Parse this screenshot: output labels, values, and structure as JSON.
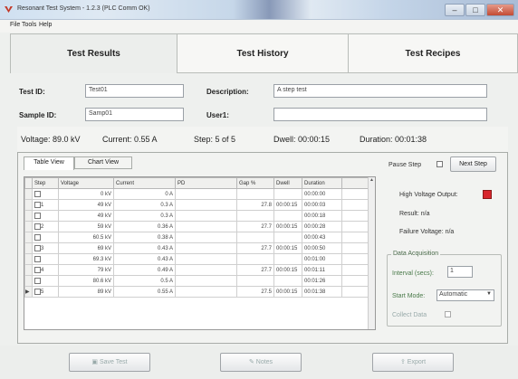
{
  "window": {
    "title": "Resonant Test System - 1.2.3 (PLC Comm OK)",
    "min_glyph": "–",
    "max_glyph": "□",
    "close_glyph": "✕"
  },
  "menu": [
    "File",
    "Tools",
    "Help"
  ],
  "tabs": [
    "Test Results",
    "Test History",
    "Test Recipes"
  ],
  "form": {
    "test_id_label": "Test ID:",
    "test_id_value": "Test01",
    "description_label": "Description:",
    "description_value": "A step test",
    "sample_id_label": "Sample ID:",
    "sample_id_value": "Samp01",
    "user_label": "User1:",
    "user_value": ""
  },
  "status": {
    "voltage": "Voltage: 89.0 kV",
    "current": "Current: 0.55 A",
    "step": "Step: 5 of 5",
    "dwell": "Dwell: 00:00:15",
    "duration": "Duration: 00:01:38"
  },
  "subtabs": [
    "Table View",
    "Chart View"
  ],
  "grid": {
    "columns": [
      "Step",
      "Voltage",
      "Current",
      "PD",
      "Gap %",
      "Dwell",
      "Duration"
    ],
    "rows": [
      {
        "step": "",
        "voltage": "0 kV",
        "current": "0 A",
        "pd": "",
        "gap": "",
        "dwell": "",
        "duration": "00:00:00",
        "check": false
      },
      {
        "step": "1",
        "voltage": "49 kV",
        "current": "0.3 A",
        "pd": "",
        "gap": "27.8",
        "dwell": "00:00:15",
        "duration": "00:00:03",
        "check": true
      },
      {
        "step": "",
        "voltage": "49 kV",
        "current": "0.3 A",
        "pd": "",
        "gap": "",
        "dwell": "",
        "duration": "00:00:18",
        "check": false
      },
      {
        "step": "2",
        "voltage": "59 kV",
        "current": "0.36 A",
        "pd": "",
        "gap": "27.7",
        "dwell": "00:00:15",
        "duration": "00:00:28",
        "check": true
      },
      {
        "step": "",
        "voltage": "60.5 kV",
        "current": "0.38 A",
        "pd": "",
        "gap": "",
        "dwell": "",
        "duration": "00:00:43",
        "check": false
      },
      {
        "step": "3",
        "voltage": "69 kV",
        "current": "0.43 A",
        "pd": "",
        "gap": "27.7",
        "dwell": "00:00:15",
        "duration": "00:00:50",
        "check": true
      },
      {
        "step": "",
        "voltage": "69.3 kV",
        "current": "0.43 A",
        "pd": "",
        "gap": "",
        "dwell": "",
        "duration": "00:01:00",
        "check": false
      },
      {
        "step": "4",
        "voltage": "79 kV",
        "current": "0.49 A",
        "pd": "",
        "gap": "27.7",
        "dwell": "00:00:15",
        "duration": "00:01:11",
        "check": true
      },
      {
        "step": "",
        "voltage": "80.6 kV",
        "current": "0.5 A",
        "pd": "",
        "gap": "",
        "dwell": "",
        "duration": "00:01:26",
        "check": false
      },
      {
        "step": "5",
        "voltage": "89 kV",
        "current": "0.55 A",
        "pd": "",
        "gap": "27.5",
        "dwell": "00:00:15",
        "duration": "00:01:38",
        "check": true
      }
    ]
  },
  "right": {
    "pause_step": "Pause Step",
    "next_step": "Next Step",
    "hv_output": "High Voltage Output:",
    "result": "Result:  n/a",
    "failure_voltage": "Failure Voltage:  n/a",
    "data_acq_title": "Data Acquisition",
    "interval_label": "Interval (secs):",
    "interval_value": "1",
    "start_mode_label": "Start Mode:",
    "start_mode_value": "Automatic",
    "collect_data": "Collect Data"
  },
  "bottom": {
    "save": "Save Test",
    "notes": "Notes",
    "export": "Export"
  },
  "colors": {
    "hv_indicator": "#d8262d"
  }
}
